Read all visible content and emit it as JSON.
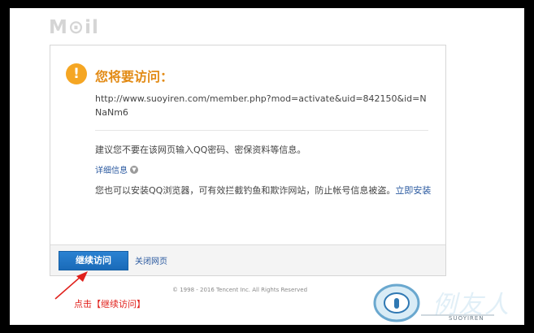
{
  "logo": {
    "text": "M⊙il"
  },
  "dialog": {
    "title": "您将要访问：",
    "url": "http://www.suoyiren.com/member.php?mod=activate&uid=842150&id=NNaNm6",
    "advice": "建议您不要在该网页输入QQ密码、密保资料等信息。",
    "details_label": "详细信息",
    "browser_text": "您也可以安装QQ浏览器，可有效拦截钓鱼和欺诈网站，防止帐号信息被盗。",
    "install_link": "立即安装",
    "continue_button": "继续访问",
    "close_link": "关闭网页"
  },
  "copyright": "© 1998 - 2016 Tencent Inc. All Rights Reserved",
  "annotation": "点击【继续访问】",
  "watermark": {
    "sub": "SUOYIREN"
  },
  "colors": {
    "accent_orange": "#e28a14",
    "button_blue": "#1a6ab8",
    "link_blue": "#2b5aa0",
    "annotation_red": "#e0201b"
  }
}
